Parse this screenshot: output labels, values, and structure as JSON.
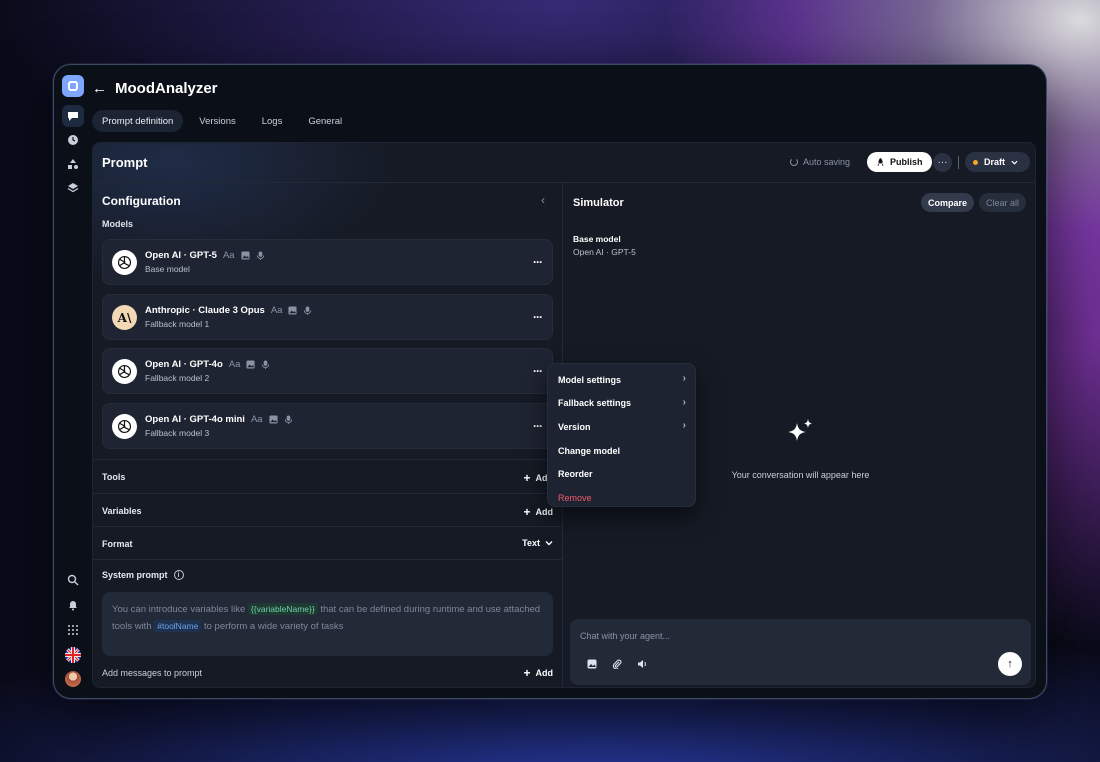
{
  "app": {
    "title": "MoodAnalyzer",
    "back_label": "←"
  },
  "tabs": [
    {
      "label": "Prompt definition",
      "active": true
    },
    {
      "label": "Versions",
      "active": false
    },
    {
      "label": "Logs",
      "active": false
    },
    {
      "label": "General",
      "active": false
    }
  ],
  "prompt": {
    "title": "Prompt",
    "autosave": "Auto saving",
    "publish": "Publish",
    "more": "···",
    "status": "Draft"
  },
  "config": {
    "title": "Configuration",
    "collapse": "‹",
    "models_label": "Models",
    "models": [
      {
        "name": "Open AI · GPT-5",
        "role": "Base model",
        "logo": "openai-icon",
        "aa": "Aa",
        "menu": "···"
      },
      {
        "name": "Anthropic · Claude 3 Opus",
        "role": "Fallback model 1",
        "logo": "anthropic-icon",
        "logo_text": "A\\",
        "aa": "Aa",
        "menu": "···"
      },
      {
        "name": "Open AI · GPT-4o",
        "role": "Fallback model 2",
        "logo": "openai-icon",
        "aa": "Aa",
        "menu": "···"
      },
      {
        "name": "Open AI · GPT-4o mini",
        "role": "Fallback model 3",
        "logo": "openai-icon",
        "aa": "Aa",
        "menu": "···"
      }
    ],
    "tools": {
      "label": "Tools",
      "action": "Add"
    },
    "variables": {
      "label": "Variables",
      "action": "Add"
    },
    "format": {
      "label": "Format",
      "value": "Text"
    },
    "system_prompt": {
      "label": "System prompt",
      "info": "i",
      "text_1": "You can introduce variables like",
      "var_token": "{{variableName}}",
      "text_2": "that can be defined during runtime and use attached tools with",
      "tool_token": "#toolName",
      "text_3": "to perform a wide variety of tasks"
    },
    "add_messages": {
      "label": "Add messages to prompt",
      "action": "Add"
    },
    "plus": "+"
  },
  "simulator": {
    "title": "Simulator",
    "compare": "Compare",
    "clear": "Clear all",
    "base_label": "Base model",
    "base_value": "Open AI · GPT-5",
    "empty": "Your conversation will appear here",
    "chat_placeholder": "Chat with your agent...",
    "send": "↑"
  },
  "dropdown": {
    "items": [
      {
        "label": "Model settings",
        "submenu": true
      },
      {
        "label": "Fallback settings",
        "submenu": true
      },
      {
        "label": "Version",
        "submenu": true
      },
      {
        "label": "Change model",
        "submenu": false
      },
      {
        "label": "Reorder",
        "submenu": false
      },
      {
        "label": "Remove",
        "submenu": false,
        "danger": true
      }
    ],
    "chevron": "›"
  },
  "colors": {
    "accent": "#7fa6ff",
    "draft_dot": "#f4a52a",
    "danger": "#f05a6b",
    "variable_token": "#6fd1a8",
    "tool_token": "#6fa3e8"
  }
}
